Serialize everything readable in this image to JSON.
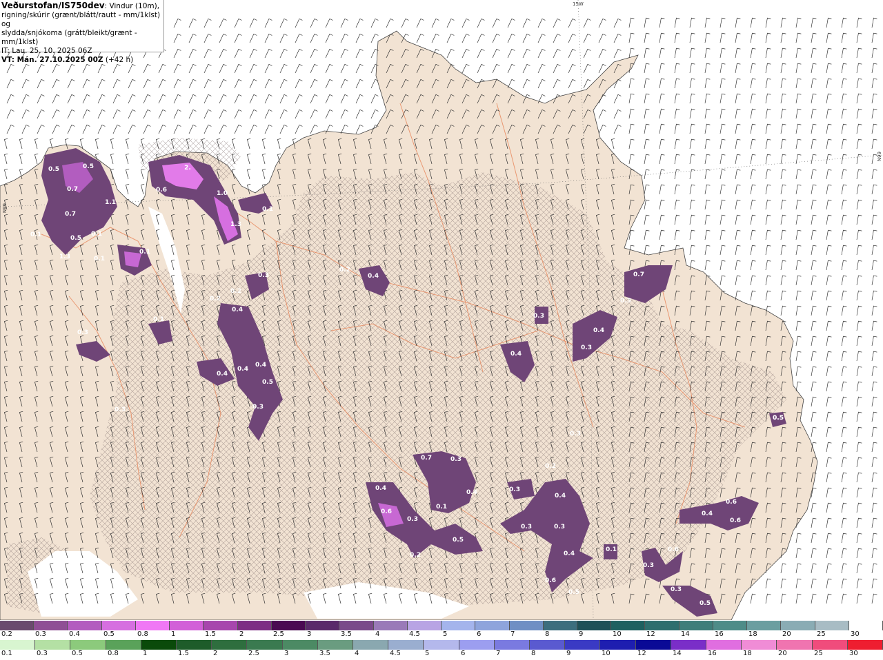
{
  "header": {
    "brand": "Veðurstofan/IS750dev",
    "desc_line1": ": Vindur (10m),",
    "desc_line2": "rigning/skúrir (grænt/blátt/rautt - mm/1klst) og",
    "desc_line3": "slydda/snjókoma (grátt/bleikt/grænt - mm/1klst)",
    "it_line": "IT: Lau. 25. 10. 2025 06Z",
    "vt_label": "VT: Mán. 27.10.2025 00Z",
    "vt_offset": " (+42 h)"
  },
  "grid_labels": {
    "top": "15W",
    "right": "66N",
    "left": "66N"
  },
  "colors": {
    "land": "#f2e3d3",
    "sea": "#ffffff",
    "roads": "#e8865a",
    "precip_light": "#7a4d86",
    "precip_mid": "#a45fb4",
    "precip_high": "#e478ec"
  },
  "precip_labels": [
    "0.5",
    "0.5",
    "0.7",
    "1.1",
    "0.7",
    "0.5",
    "0.1",
    "0.1",
    "1.3",
    "0.1",
    "0.1",
    "2.",
    "0.6",
    "1.0",
    "1.3",
    "0.1",
    "0.2",
    "0.4",
    "0.4",
    "0.5",
    "0.4",
    "0.4",
    "0.3",
    "0.2",
    "0.3",
    "0.3",
    "0.1",
    "0.4",
    "0.2",
    "0.3",
    "0.3",
    "0.4",
    "0.4",
    "0.3",
    "0.7",
    "0.3",
    "0.5",
    "0.6",
    "0.3",
    "0.3",
    "0.4",
    "0.7",
    "0.4",
    "0.2",
    "0.5",
    "0.3",
    "0.2",
    "0.3",
    "0.4",
    "0.3",
    "0.4",
    "0.3",
    "0.1",
    "0.6",
    "0.3",
    "0.4",
    "0.6",
    "0.6",
    "0.6",
    "0.3",
    "0.5",
    "0.5",
    "0.5",
    "0.1"
  ],
  "legend_snow": {
    "labels": [
      "0.2",
      "0.3",
      "0.4",
      "0.5",
      "0.8",
      "1",
      "1.5",
      "2",
      "2.5",
      "3",
      "3.5",
      "4",
      "4.5",
      "5",
      "6",
      "7",
      "8",
      "9",
      "10",
      "12",
      "14",
      "16",
      "18",
      "20",
      "25",
      "30"
    ],
    "colors": [
      "#6a4a6e",
      "#8f4f95",
      "#b35cbf",
      "#d66fe0",
      "#f078f5",
      "#d25fd8",
      "#a746ad",
      "#7d2e84",
      "#4a0a52",
      "#5a2a6a",
      "#7a4a8a",
      "#9a7ab8",
      "#b8a4e4",
      "#a4b4ec",
      "#8ea4dc",
      "#6f8fc4",
      "#3c6e7e",
      "#1e5058",
      "#1f6060",
      "#2e6e6e",
      "#3e7e7a",
      "#4e8c88",
      "#6b9ea0",
      "#8aacb4",
      "#a8bcc4",
      "#ffffff"
    ]
  },
  "legend_rain": {
    "labels": [
      "0.1",
      "0.3",
      "0.5",
      "0.8",
      "1",
      "1.5",
      "2",
      "2.5",
      "3",
      "3.5",
      "4",
      "4.5",
      "5",
      "6",
      "7",
      "8",
      "9",
      "10",
      "12",
      "14",
      "16",
      "18",
      "20",
      "25",
      "30"
    ],
    "colors": [
      "#d8f5d0",
      "#b4e0a4",
      "#8cca7c",
      "#5aa25a",
      "#0a4a0a",
      "#1e5c2a",
      "#2e6e3e",
      "#3a7a50",
      "#4c8a64",
      "#6a9c80",
      "#8aa8b0",
      "#9aaed0",
      "#b4b8ec",
      "#9c9ef0",
      "#7a7ae0",
      "#5a5ad0",
      "#3a3ac4",
      "#1e1eb0",
      "#0a0a96",
      "#7a2ec8",
      "#e06ee0",
      "#f08cd6",
      "#f074b0",
      "#f04c7c",
      "#ee1e30"
    ]
  }
}
